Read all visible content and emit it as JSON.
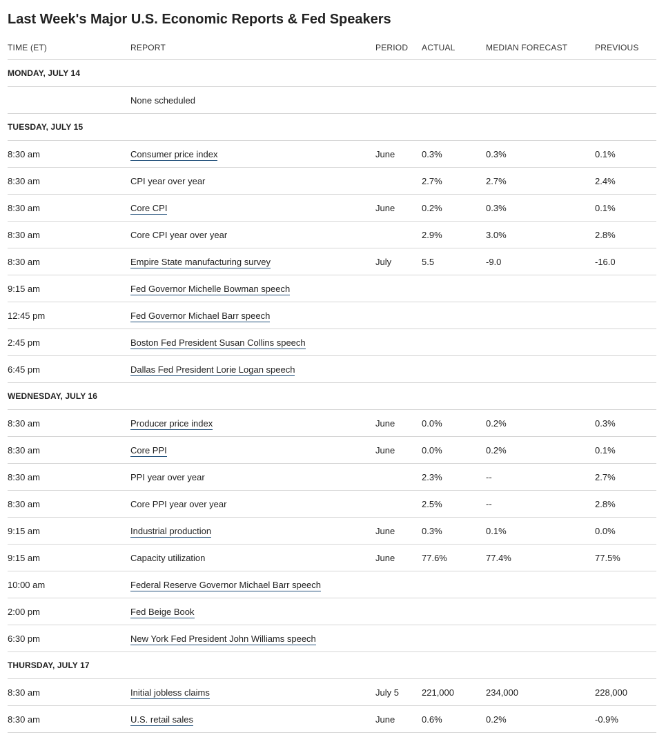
{
  "title": "Last Week's Major U.S. Economic Reports & Fed Speakers",
  "columns": {
    "time": "TIME (ET)",
    "report": "REPORT",
    "period": "PERIOD",
    "actual": "ACTUAL",
    "forecast": "MEDIAN FORECAST",
    "previous": "PREVIOUS"
  },
  "rows": [
    {
      "type": "day",
      "label": "MONDAY, JULY 14"
    },
    {
      "type": "row",
      "time": "",
      "report": "None scheduled",
      "link": false,
      "period": "",
      "actual": "",
      "forecast": "",
      "previous": ""
    },
    {
      "type": "day",
      "label": "TUESDAY, JULY 15"
    },
    {
      "type": "row",
      "time": "8:30 am",
      "report": "Consumer price index",
      "link": true,
      "period": "June",
      "actual": "0.3%",
      "forecast": "0.3%",
      "previous": "0.1%"
    },
    {
      "type": "row",
      "time": "8:30 am",
      "report": "CPI year over year",
      "link": false,
      "period": "",
      "actual": "2.7%",
      "forecast": "2.7%",
      "previous": "2.4%"
    },
    {
      "type": "row",
      "time": "8:30 am",
      "report": "Core CPI",
      "link": true,
      "period": "June",
      "actual": "0.2%",
      "forecast": "0.3%",
      "previous": "0.1%"
    },
    {
      "type": "row",
      "time": "8:30 am",
      "report": "Core CPI year over year",
      "link": false,
      "period": "",
      "actual": "2.9%",
      "forecast": "3.0%",
      "previous": "2.8%"
    },
    {
      "type": "row",
      "time": "8:30 am",
      "report": "Empire State manufacturing survey",
      "link": true,
      "period": "July",
      "actual": "5.5",
      "forecast": "-9.0",
      "previous": "-16.0"
    },
    {
      "type": "row",
      "time": "9:15 am",
      "report": "Fed Governor Michelle Bowman speech",
      "link": true,
      "period": "",
      "actual": "",
      "forecast": "",
      "previous": ""
    },
    {
      "type": "row",
      "time": "12:45 pm",
      "report": "Fed Governor Michael Barr speech",
      "link": true,
      "period": "",
      "actual": "",
      "forecast": "",
      "previous": ""
    },
    {
      "type": "row",
      "time": "2:45 pm",
      "report": "Boston Fed President Susan Collins speech",
      "link": true,
      "period": "",
      "actual": "",
      "forecast": "",
      "previous": ""
    },
    {
      "type": "row",
      "time": "6:45 pm",
      "report": "Dallas Fed President Lorie Logan speech",
      "link": true,
      "period": "",
      "actual": "",
      "forecast": "",
      "previous": ""
    },
    {
      "type": "day",
      "label": "WEDNESDAY, JULY 16"
    },
    {
      "type": "row",
      "time": "8:30 am",
      "report": "Producer price index",
      "link": true,
      "period": "June",
      "actual": "0.0%",
      "forecast": "0.2%",
      "previous": "0.3%"
    },
    {
      "type": "row",
      "time": "8:30 am",
      "report": "Core PPI",
      "link": true,
      "period": "June",
      "actual": "0.0%",
      "forecast": "0.2%",
      "previous": "0.1%"
    },
    {
      "type": "row",
      "time": "8:30 am",
      "report": "PPI year over year",
      "link": false,
      "period": "",
      "actual": "2.3%",
      "forecast": "--",
      "previous": "2.7%"
    },
    {
      "type": "row",
      "time": "8:30 am",
      "report": "Core PPI year over year",
      "link": false,
      "period": "",
      "actual": "2.5%",
      "forecast": "--",
      "previous": "2.8%"
    },
    {
      "type": "row",
      "time": "9:15 am",
      "report": "Industrial production",
      "link": true,
      "period": "June",
      "actual": "0.3%",
      "forecast": "0.1%",
      "previous": "0.0%"
    },
    {
      "type": "row",
      "time": "9:15 am",
      "report": "Capacity utilization",
      "link": false,
      "period": "June",
      "actual": "77.6%",
      "forecast": "77.4%",
      "previous": "77.5%"
    },
    {
      "type": "row",
      "time": "10:00 am",
      "report": "Federal Reserve Governor Michael Barr speech",
      "link": true,
      "period": "",
      "actual": "",
      "forecast": "",
      "previous": ""
    },
    {
      "type": "row",
      "time": "2:00 pm",
      "report": "Fed Beige Book",
      "link": true,
      "period": "",
      "actual": "",
      "forecast": "",
      "previous": ""
    },
    {
      "type": "row",
      "time": "6:30 pm",
      "report": "New York Fed President John Williams speech",
      "link": true,
      "period": "",
      "actual": "",
      "forecast": "",
      "previous": ""
    },
    {
      "type": "day",
      "label": "THURSDAY, JULY 17"
    },
    {
      "type": "row",
      "time": "8:30 am",
      "report": "Initial jobless claims",
      "link": true,
      "period": "July 5",
      "actual": "221,000",
      "forecast": "234,000",
      "previous": "228,000"
    },
    {
      "type": "row",
      "time": "8:30 am",
      "report": "U.S. retail sales",
      "link": true,
      "period": "June",
      "actual": "0.6%",
      "forecast": "0.2%",
      "previous": "-0.9%"
    }
  ]
}
